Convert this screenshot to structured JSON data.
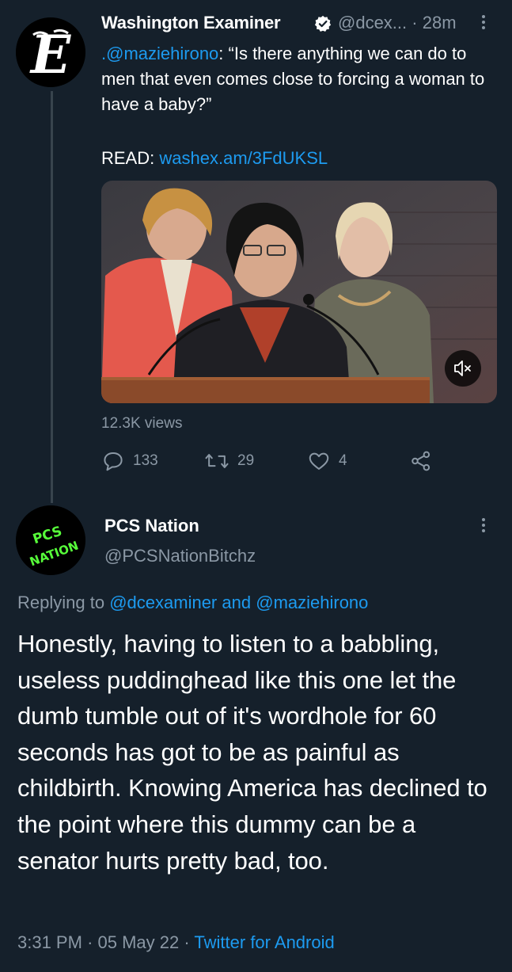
{
  "tweet": {
    "author_name": "Washington Examiner",
    "author_handle": "@dcex...",
    "time": "28m",
    "dot": "·",
    "text_mention": ".@maziehirono",
    "text_body": ": “Is there anything we can do to men that even comes close to forcing a woman to have a baby?”",
    "read_label": "READ:",
    "read_link": "washex.am/3FdUKSL",
    "views": "12.3K views",
    "reply_count": "133",
    "retweet_count": "29",
    "like_count": "4"
  },
  "reply": {
    "author_name": "PCS Nation",
    "author_handle": "@PCSNationBitchz",
    "avatar_text_1": "PCS",
    "avatar_text_2": "NATION",
    "replying_to_label": "Replying to",
    "replying_to_1": "@dcexaminer",
    "replying_to_and": "and",
    "replying_to_2": "@maziehirono",
    "text": "Honestly, having to listen to a babbling, useless puddinghead like this one let the dumb tumble out of it's wordhole for 60 seconds has got to be as painful as childbirth. Knowing America has declined to the point where this dummy can be a senator hurts pretty bad, too.",
    "time": "3:31 PM",
    "date": "05 May 22",
    "sep": "·",
    "source": "Twitter for Android"
  },
  "colors": {
    "background": "#15202b",
    "accent": "#1d9bf0",
    "secondary_text": "#8b98a5",
    "avatar_green": "#57ff3a"
  },
  "icons": [
    "more-icon",
    "verified-badge-icon",
    "mute-icon",
    "reply-icon",
    "retweet-icon",
    "like-icon",
    "share-icon"
  ]
}
